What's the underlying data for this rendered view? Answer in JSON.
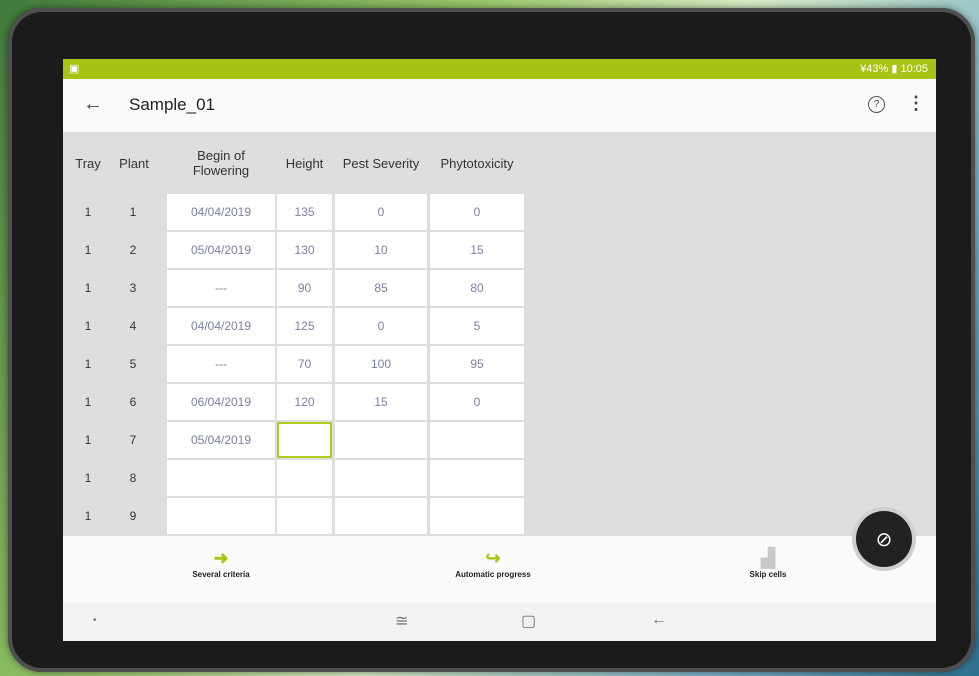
{
  "status": {
    "right": "¥43% ▮ 10:05",
    "left_icon": "image-icon"
  },
  "appbar": {
    "back": "←",
    "title": "Sample_01",
    "help": "?",
    "more": "⋮"
  },
  "columns": [
    "Tray",
    "Plant",
    "Begin of\nFlowering",
    "Height",
    "Pest Severity",
    "Phytotoxicity"
  ],
  "rows": [
    {
      "tray": "1",
      "plant": "1",
      "flowering": "04/04/2019",
      "height": "135",
      "pest": "0",
      "phyto": "0"
    },
    {
      "tray": "1",
      "plant": "2",
      "flowering": "05/04/2019",
      "height": "130",
      "pest": "10",
      "phyto": "15"
    },
    {
      "tray": "1",
      "plant": "3",
      "flowering": "---",
      "height": "90",
      "pest": "85",
      "phyto": "80"
    },
    {
      "tray": "1",
      "plant": "4",
      "flowering": "04/04/2019",
      "height": "125",
      "pest": "0",
      "phyto": "5"
    },
    {
      "tray": "1",
      "plant": "5",
      "flowering": "---",
      "height": "70",
      "pest": "100",
      "phyto": "95"
    },
    {
      "tray": "1",
      "plant": "6",
      "flowering": "06/04/2019",
      "height": "120",
      "pest": "15",
      "phyto": "0"
    },
    {
      "tray": "1",
      "plant": "7",
      "flowering": "05/04/2019",
      "height": "",
      "pest": "",
      "phyto": ""
    },
    {
      "tray": "1",
      "plant": "8",
      "flowering": "",
      "height": "",
      "pest": "",
      "phyto": ""
    },
    {
      "tray": "1",
      "plant": "9",
      "flowering": "",
      "height": "",
      "pest": "",
      "phyto": ""
    }
  ],
  "bottom": {
    "several_criteria": "Several criteria",
    "automatic_progress": "Automatic progress",
    "skip_cells": "Skip cells"
  },
  "nav": {
    "recent": "≅",
    "home": "▢",
    "back": "←",
    "dot": "•"
  },
  "fab": {
    "icon": "mic-off-icon",
    "glyph": "⊘"
  }
}
